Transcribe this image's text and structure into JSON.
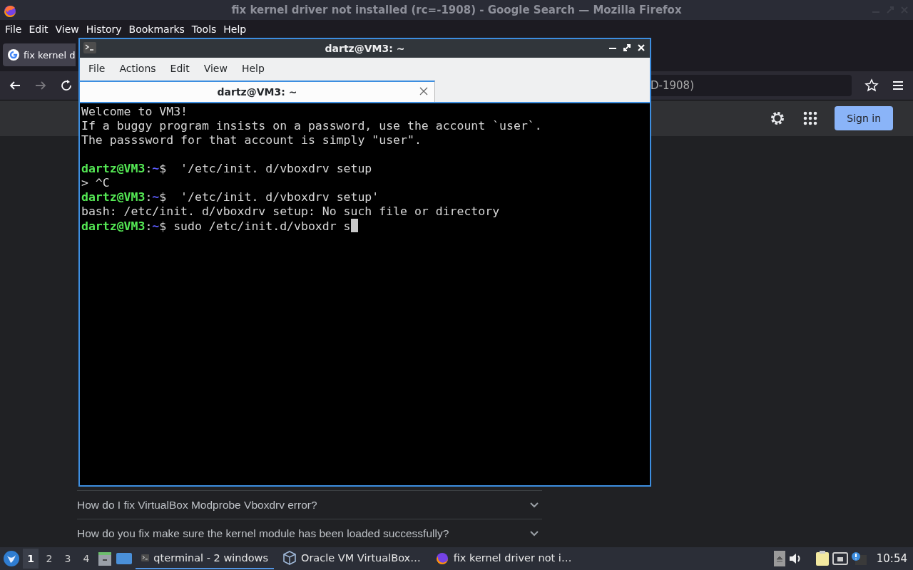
{
  "browser": {
    "title": "fix kernel driver not installed (rc=-1908) - Google Search — Mozilla Firefox",
    "menu": [
      "File",
      "Edit",
      "View",
      "History",
      "Bookmarks",
      "Tools",
      "Help"
    ],
    "tabs": [
      {
        "label": "fix kernel d",
        "selected": true
      }
    ],
    "address": "D-1908)",
    "header": {
      "sign_in": "Sign in"
    },
    "faq": [
      {
        "question": "How do I fix VirtualBox Modprobe Vboxdrv error?",
        "expanded": false
      },
      {
        "question": "How do you fix make sure the kernel module has been loaded successfully?",
        "expanded": false
      }
    ]
  },
  "terminal": {
    "title": "dartz@VM3: ~",
    "menu": [
      "File",
      "Actions",
      "Edit",
      "View",
      "Help"
    ],
    "tabs": [
      {
        "label": "dartz@VM3: ~",
        "selected": true
      }
    ],
    "lines": [
      {
        "kind": "output",
        "text": "Welcome to VM3!"
      },
      {
        "kind": "output",
        "text": "If a buggy program insists on a password, use the account `user`."
      },
      {
        "kind": "output",
        "text": "The passsword for that account is simply \"user\"."
      },
      {
        "kind": "blank"
      },
      {
        "kind": "prompt",
        "user": "dartz@VM3",
        "sep": ":",
        "path": "~",
        "symbol": "$",
        "command": "  '/etc/init. d/vboxdrv setup",
        "cursor": false
      },
      {
        "kind": "output",
        "text": "> ^C"
      },
      {
        "kind": "prompt",
        "user": "dartz@VM3",
        "sep": ":",
        "path": "~",
        "symbol": "$",
        "command": "  '/etc/init. d/vboxdrv setup'",
        "cursor": false
      },
      {
        "kind": "output",
        "text": "bash: /etc/init. d/vboxdrv setup: No such file or directory"
      },
      {
        "kind": "prompt",
        "user": "dartz@VM3",
        "sep": ":",
        "path": "~",
        "symbol": "$",
        "command": " sudo /etc/init.d/vboxdr s",
        "cursor": true
      }
    ]
  },
  "taskbar": {
    "workspaces": [
      {
        "label": "1",
        "selected": true
      },
      {
        "label": "2",
        "selected": false
      },
      {
        "label": "3",
        "selected": false
      },
      {
        "label": "4",
        "selected": false
      }
    ],
    "tasks": [
      {
        "kind": "terminal",
        "label": "qterminal - 2 windows",
        "selected": true
      },
      {
        "kind": "virtualbox",
        "label": "Oracle VM VirtualBox…",
        "selected": false
      },
      {
        "kind": "firefox",
        "label": "fix kernel driver not i…",
        "selected": false
      }
    ],
    "clock": "10:54"
  }
}
